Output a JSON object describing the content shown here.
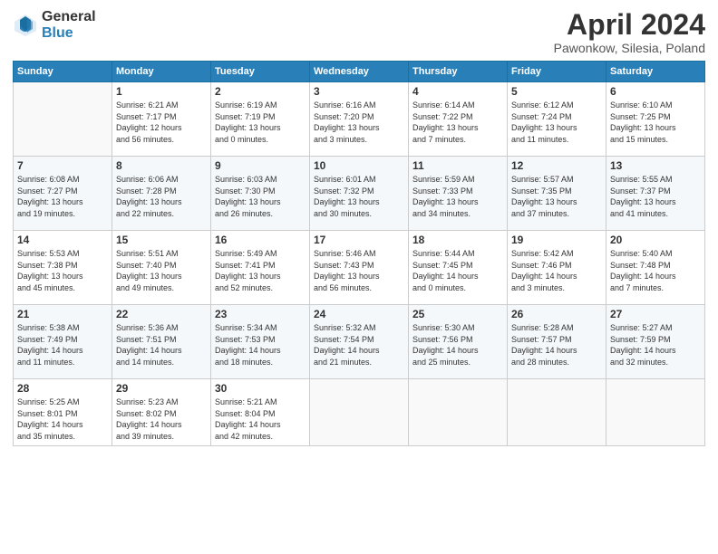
{
  "logo": {
    "general": "General",
    "blue": "Blue"
  },
  "title": "April 2024",
  "subtitle": "Pawonkow, Silesia, Poland",
  "days_header": [
    "Sunday",
    "Monday",
    "Tuesday",
    "Wednesday",
    "Thursday",
    "Friday",
    "Saturday"
  ],
  "weeks": [
    [
      {
        "day": "",
        "info": ""
      },
      {
        "day": "1",
        "info": "Sunrise: 6:21 AM\nSunset: 7:17 PM\nDaylight: 12 hours\nand 56 minutes."
      },
      {
        "day": "2",
        "info": "Sunrise: 6:19 AM\nSunset: 7:19 PM\nDaylight: 13 hours\nand 0 minutes."
      },
      {
        "day": "3",
        "info": "Sunrise: 6:16 AM\nSunset: 7:20 PM\nDaylight: 13 hours\nand 3 minutes."
      },
      {
        "day": "4",
        "info": "Sunrise: 6:14 AM\nSunset: 7:22 PM\nDaylight: 13 hours\nand 7 minutes."
      },
      {
        "day": "5",
        "info": "Sunrise: 6:12 AM\nSunset: 7:24 PM\nDaylight: 13 hours\nand 11 minutes."
      },
      {
        "day": "6",
        "info": "Sunrise: 6:10 AM\nSunset: 7:25 PM\nDaylight: 13 hours\nand 15 minutes."
      }
    ],
    [
      {
        "day": "7",
        "info": "Sunrise: 6:08 AM\nSunset: 7:27 PM\nDaylight: 13 hours\nand 19 minutes."
      },
      {
        "day": "8",
        "info": "Sunrise: 6:06 AM\nSunset: 7:28 PM\nDaylight: 13 hours\nand 22 minutes."
      },
      {
        "day": "9",
        "info": "Sunrise: 6:03 AM\nSunset: 7:30 PM\nDaylight: 13 hours\nand 26 minutes."
      },
      {
        "day": "10",
        "info": "Sunrise: 6:01 AM\nSunset: 7:32 PM\nDaylight: 13 hours\nand 30 minutes."
      },
      {
        "day": "11",
        "info": "Sunrise: 5:59 AM\nSunset: 7:33 PM\nDaylight: 13 hours\nand 34 minutes."
      },
      {
        "day": "12",
        "info": "Sunrise: 5:57 AM\nSunset: 7:35 PM\nDaylight: 13 hours\nand 37 minutes."
      },
      {
        "day": "13",
        "info": "Sunrise: 5:55 AM\nSunset: 7:37 PM\nDaylight: 13 hours\nand 41 minutes."
      }
    ],
    [
      {
        "day": "14",
        "info": "Sunrise: 5:53 AM\nSunset: 7:38 PM\nDaylight: 13 hours\nand 45 minutes."
      },
      {
        "day": "15",
        "info": "Sunrise: 5:51 AM\nSunset: 7:40 PM\nDaylight: 13 hours\nand 49 minutes."
      },
      {
        "day": "16",
        "info": "Sunrise: 5:49 AM\nSunset: 7:41 PM\nDaylight: 13 hours\nand 52 minutes."
      },
      {
        "day": "17",
        "info": "Sunrise: 5:46 AM\nSunset: 7:43 PM\nDaylight: 13 hours\nand 56 minutes."
      },
      {
        "day": "18",
        "info": "Sunrise: 5:44 AM\nSunset: 7:45 PM\nDaylight: 14 hours\nand 0 minutes."
      },
      {
        "day": "19",
        "info": "Sunrise: 5:42 AM\nSunset: 7:46 PM\nDaylight: 14 hours\nand 3 minutes."
      },
      {
        "day": "20",
        "info": "Sunrise: 5:40 AM\nSunset: 7:48 PM\nDaylight: 14 hours\nand 7 minutes."
      }
    ],
    [
      {
        "day": "21",
        "info": "Sunrise: 5:38 AM\nSunset: 7:49 PM\nDaylight: 14 hours\nand 11 minutes."
      },
      {
        "day": "22",
        "info": "Sunrise: 5:36 AM\nSunset: 7:51 PM\nDaylight: 14 hours\nand 14 minutes."
      },
      {
        "day": "23",
        "info": "Sunrise: 5:34 AM\nSunset: 7:53 PM\nDaylight: 14 hours\nand 18 minutes."
      },
      {
        "day": "24",
        "info": "Sunrise: 5:32 AM\nSunset: 7:54 PM\nDaylight: 14 hours\nand 21 minutes."
      },
      {
        "day": "25",
        "info": "Sunrise: 5:30 AM\nSunset: 7:56 PM\nDaylight: 14 hours\nand 25 minutes."
      },
      {
        "day": "26",
        "info": "Sunrise: 5:28 AM\nSunset: 7:57 PM\nDaylight: 14 hours\nand 28 minutes."
      },
      {
        "day": "27",
        "info": "Sunrise: 5:27 AM\nSunset: 7:59 PM\nDaylight: 14 hours\nand 32 minutes."
      }
    ],
    [
      {
        "day": "28",
        "info": "Sunrise: 5:25 AM\nSunset: 8:01 PM\nDaylight: 14 hours\nand 35 minutes."
      },
      {
        "day": "29",
        "info": "Sunrise: 5:23 AM\nSunset: 8:02 PM\nDaylight: 14 hours\nand 39 minutes."
      },
      {
        "day": "30",
        "info": "Sunrise: 5:21 AM\nSunset: 8:04 PM\nDaylight: 14 hours\nand 42 minutes."
      },
      {
        "day": "",
        "info": ""
      },
      {
        "day": "",
        "info": ""
      },
      {
        "day": "",
        "info": ""
      },
      {
        "day": "",
        "info": ""
      }
    ]
  ]
}
